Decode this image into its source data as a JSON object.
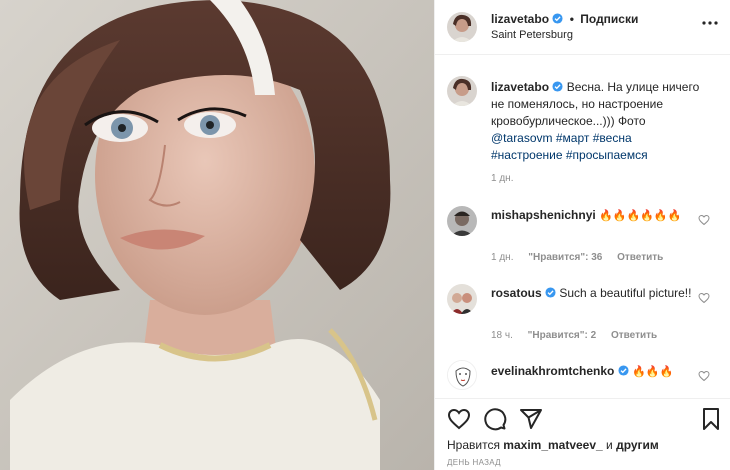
{
  "post": {
    "author": "lizavetabo",
    "location": "Saint Petersburg",
    "follow_label": "Подписки",
    "separator": "•",
    "caption_text": "Весна. На улице ничего не поменялось, но настроение кровобурлическое...))) Фото",
    "caption_mention": "@tarasovm",
    "caption_tags": [
      "#март",
      "#весна",
      "#настроение",
      "#просыпаемся"
    ],
    "caption_time": "1 дн."
  },
  "comments": [
    {
      "user": "mishapshenichnyi",
      "verified": false,
      "text": "🔥🔥🔥🔥🔥🔥",
      "time": "1 дн.",
      "likes": "\"Нравится\": 36",
      "reply": "Ответить"
    },
    {
      "user": "rosatous",
      "verified": true,
      "text": "Such a beautiful picture!!",
      "time": "18 ч.",
      "likes": "\"Нравится\": 2",
      "reply": "Ответить"
    },
    {
      "user": "evelinakhromtchenko",
      "verified": true,
      "text": "🔥🔥🔥",
      "time": "",
      "likes": "",
      "reply": ""
    }
  ],
  "likes_line": {
    "prefix": "Нравится",
    "user": "maxim_matveev_",
    "middle": "и",
    "others": "другим"
  },
  "date_label": "ДЕНЬ НАЗАД",
  "colors": {
    "link": "#00376b",
    "verified": "#3897f0",
    "muted": "#8e8e8e",
    "text": "#262626"
  },
  "icons": [
    "more-options-icon",
    "verified-badge-icon",
    "heart-icon",
    "comment-icon",
    "share-icon",
    "bookmark-icon"
  ]
}
